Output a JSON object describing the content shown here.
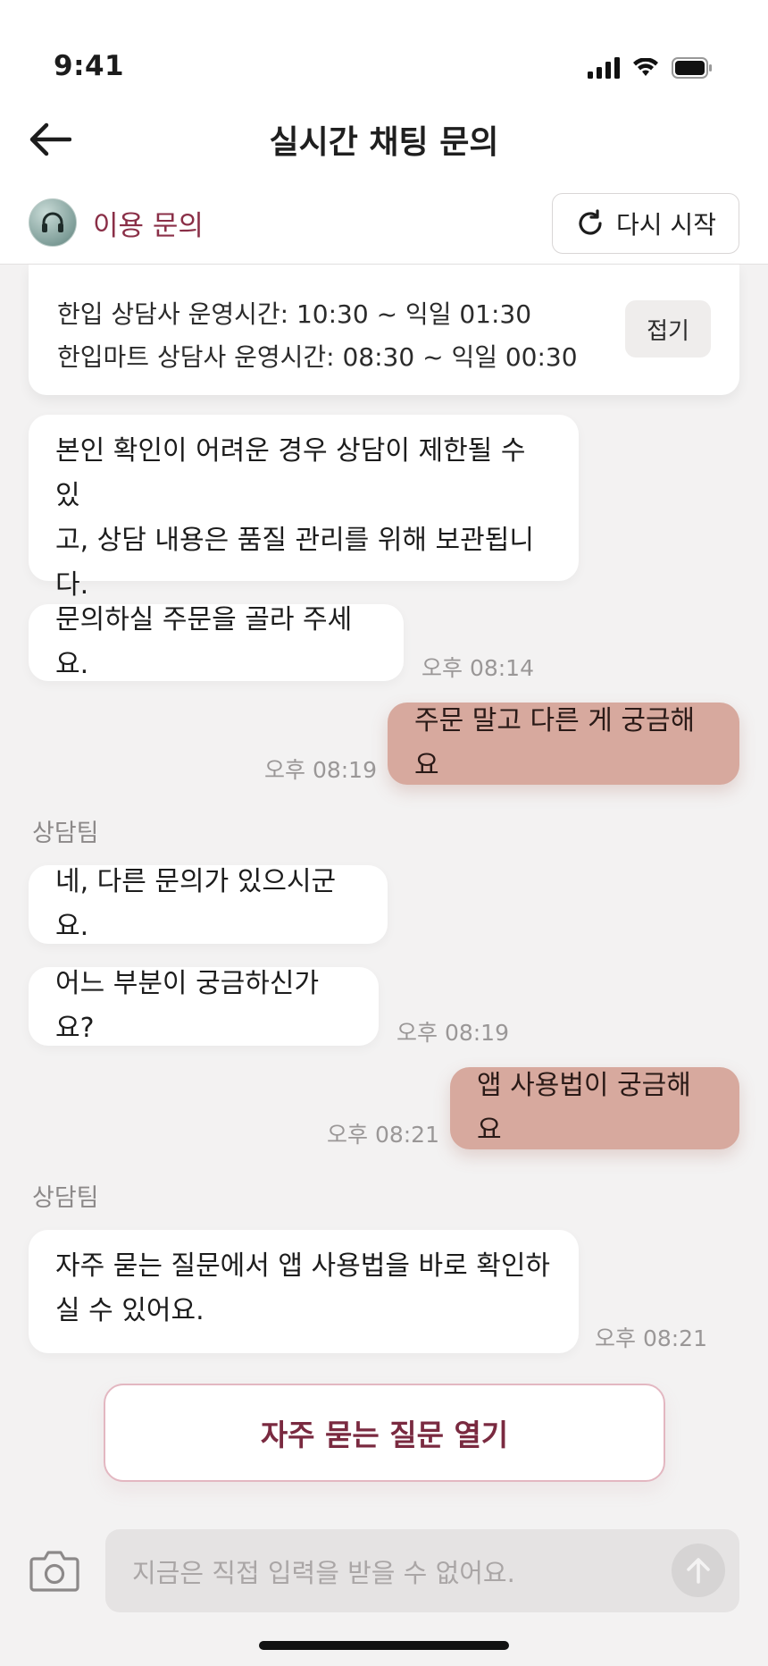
{
  "status_bar": {
    "time": "9:41",
    "icons": [
      "signal-icon",
      "wifi-icon",
      "battery-icon"
    ]
  },
  "nav": {
    "title": "실시간 채팅 문의",
    "back_icon": "back-arrow-icon"
  },
  "topic": {
    "label": "이용 문의",
    "avatar_icon": "headset-icon",
    "restart_label": "다시 시작",
    "restart_icon": "refresh-icon"
  },
  "info": {
    "lines": [
      "한입 상담사 운영시간: 10:30 ~ 익일 01:30",
      "한입마트 상담사 운영시간: 08:30 ~ 익일 00:30"
    ],
    "fold_label": "접기"
  },
  "messages": [
    {
      "from": "agent",
      "lines": [
        "본인 확인이 어려운 경우 상담이 제한될 수 있",
        "고, 상담 내용은 품질 관리를 위해 보관됩니",
        "다."
      ],
      "time": ""
    },
    {
      "from": "agent",
      "text": "문의하실 주문을 골라 주세요.",
      "time": "오후 08:14"
    },
    {
      "from": "me",
      "text": "주문 말고 다른 게 궁금해요",
      "time": "오후 08:19"
    },
    {
      "from": "sender",
      "text": "상담팀"
    },
    {
      "from": "agent",
      "text": "네, 다른 문의가 있으시군요.",
      "time": ""
    },
    {
      "from": "agent",
      "text": "어느 부분이 궁금하신가요?",
      "time": "오후 08:19"
    },
    {
      "from": "me",
      "text": "앱 사용법이 궁금해요",
      "time": "오후 08:21"
    },
    {
      "from": "sender",
      "text": "상담팀"
    },
    {
      "from": "agent",
      "lines": [
        "자주 묻는 질문에서 앱 사용법을 바로 확인하",
        "실 수 있어요."
      ],
      "time": "오후 08:21"
    }
  ],
  "faq_button": {
    "label": "자주 묻는 질문 열기"
  },
  "composer": {
    "placeholder": "지금은 직접 입력을 받을 수 없어요.",
    "camera_icon": "camera-icon",
    "send_icon": "send-arrow-icon"
  },
  "colors": {
    "accent": "#8a2f47",
    "my_bubble": "#d7a99e",
    "faq_border": "#e3b7c1",
    "background": "#f3f2f2"
  }
}
